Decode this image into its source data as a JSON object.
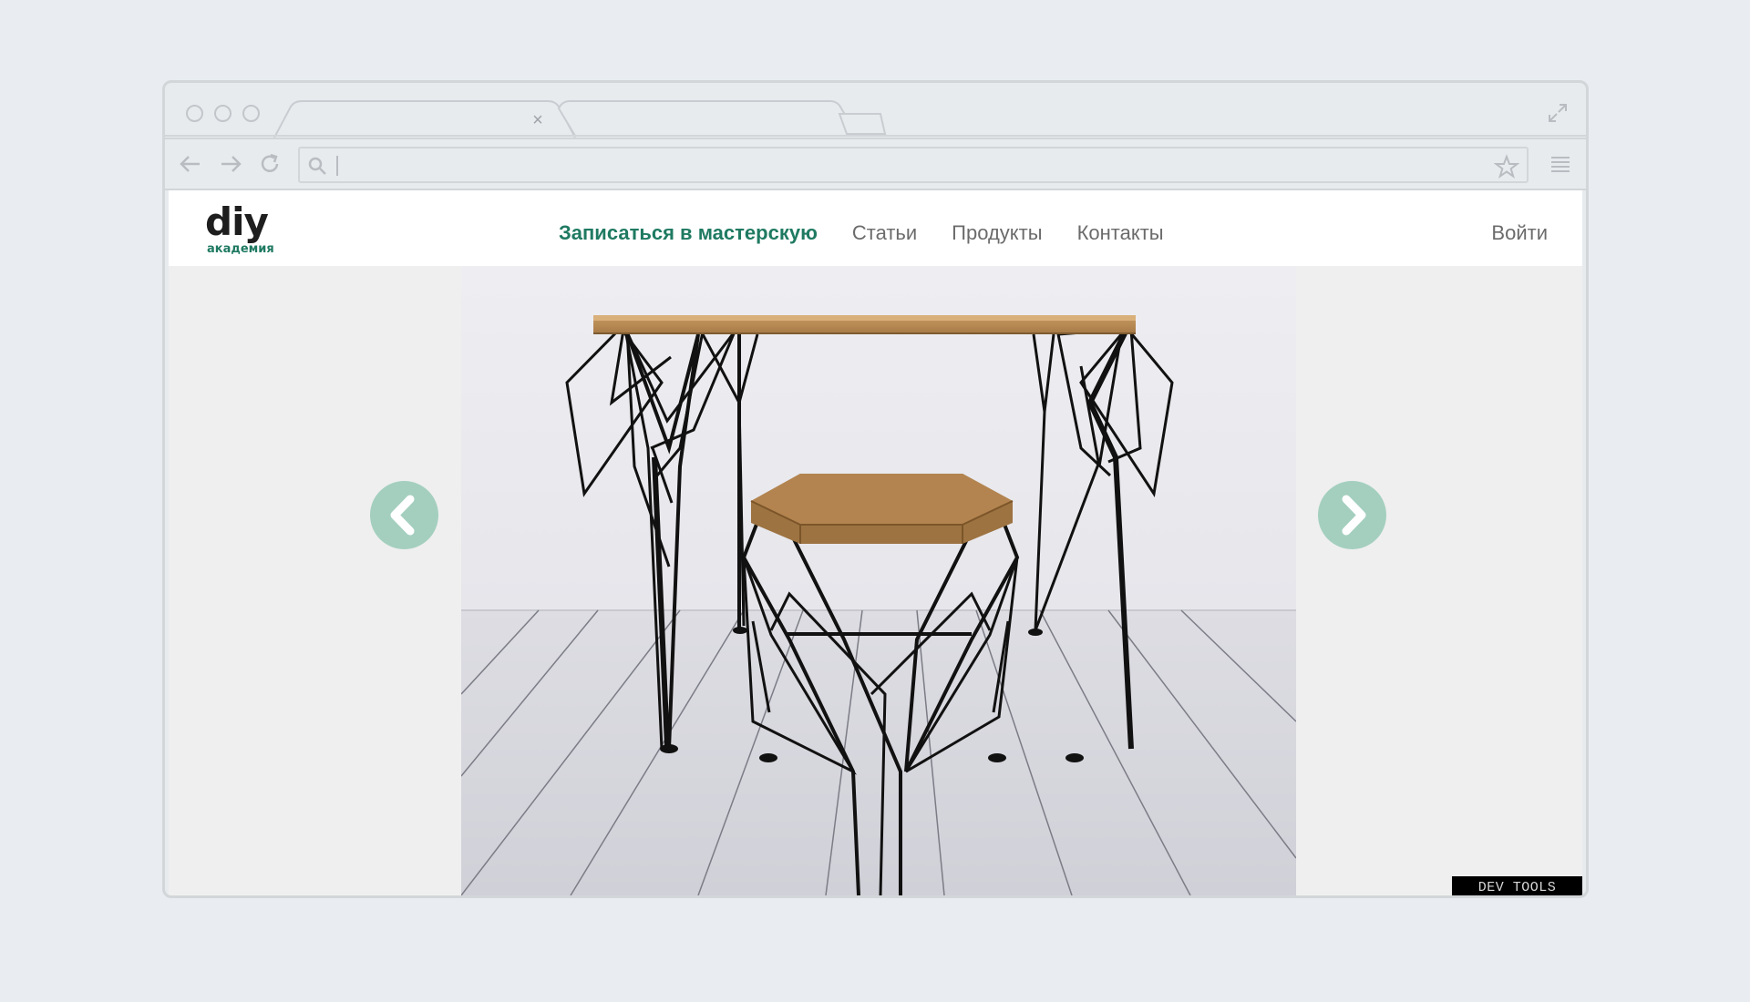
{
  "browser": {
    "url_value": "",
    "url_placeholder": ""
  },
  "site": {
    "logo": {
      "main": "diy",
      "sub": "академия"
    },
    "nav": [
      {
        "label": "Записаться в мастерскую",
        "primary": true
      },
      {
        "label": "Статьи"
      },
      {
        "label": "Продукты"
      },
      {
        "label": "Контакты"
      }
    ],
    "login_label": "Войти"
  },
  "slider": {
    "prev_icon": "chevron-left-icon",
    "next_icon": "chevron-right-icon",
    "arrow_color": "#a4cfbf"
  },
  "devtools_label": "DEV TOOLS",
  "colors": {
    "accent": "#1f7a62",
    "page_bg": "#e9edf1",
    "viewport_bg": "#efefef"
  }
}
